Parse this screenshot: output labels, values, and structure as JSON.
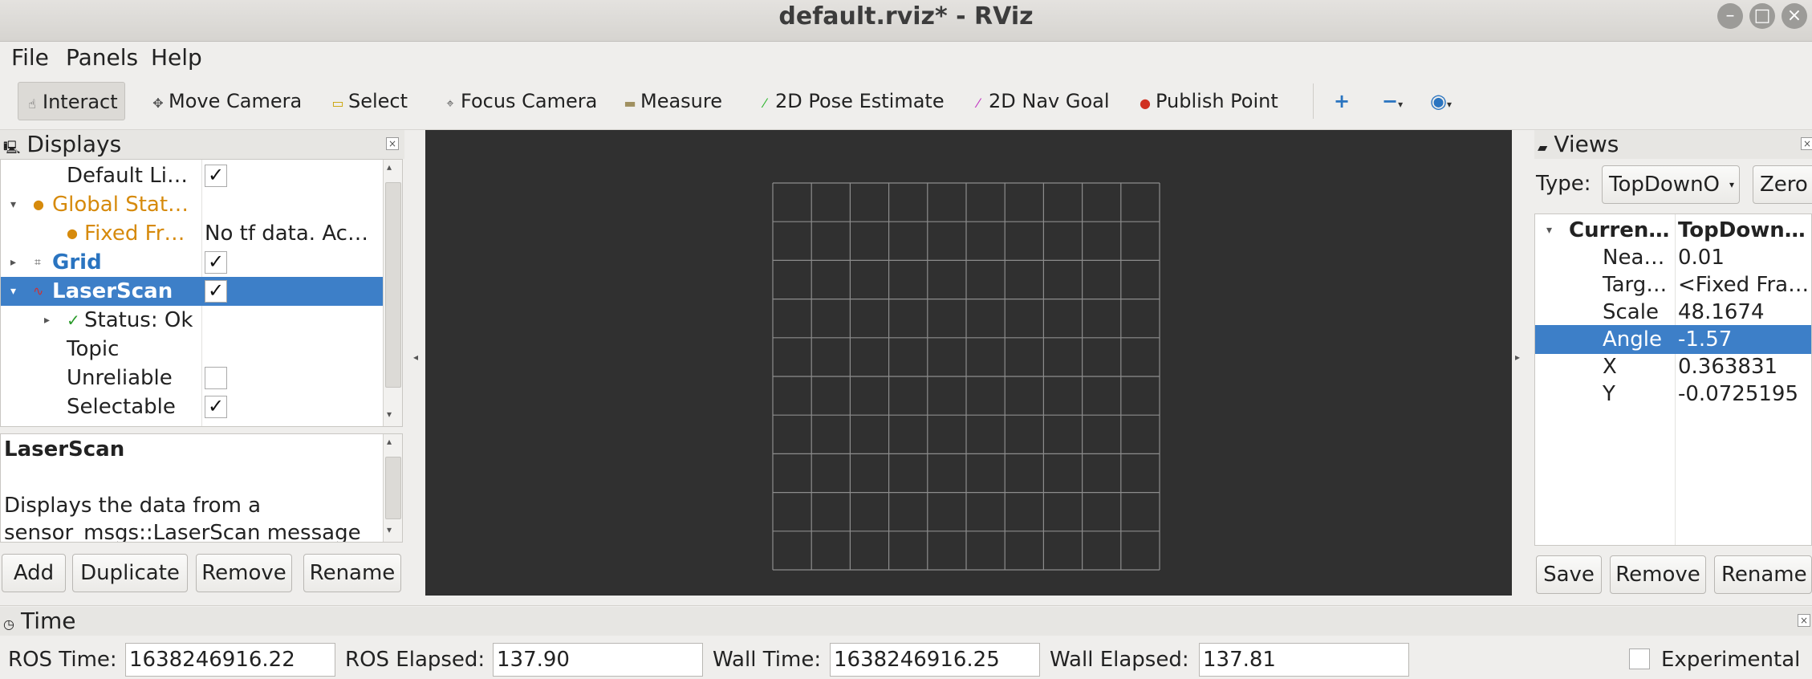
{
  "window": {
    "title": "default.rviz* - RViz"
  },
  "menu": [
    "File",
    "Panels",
    "Help"
  ],
  "toolbar": {
    "interact": "Interact",
    "move_camera": "Move Camera",
    "select": "Select",
    "focus_camera": "Focus Camera",
    "measure": "Measure",
    "pose_estimate": "2D Pose Estimate",
    "nav_goal": "2D Nav Goal",
    "publish_point": "Publish Point",
    "icons": [
      "plus-icon",
      "minus-icon",
      "eye-icon"
    ]
  },
  "displays": {
    "title": "Displays",
    "rows": [
      {
        "label": "Default Li…",
        "value": "✓"
      },
      {
        "label": "Global Stat…",
        "value": ""
      },
      {
        "label": "Fixed Fr…",
        "value": "No tf data.  Ac…"
      },
      {
        "label": "Grid",
        "value": "✓"
      },
      {
        "label": "LaserScan",
        "value": "✓"
      },
      {
        "label": "Status: Ok",
        "value": ""
      },
      {
        "label": "Topic",
        "value": ""
      },
      {
        "label": "Unreliable",
        "value": ""
      },
      {
        "label": "Selectable",
        "value": "✓"
      }
    ],
    "desc_title": "LaserScan",
    "desc_text_1": "Displays the data from a",
    "desc_text_2": "sensor_msgs::LaserScan message",
    "buttons": {
      "add": "Add",
      "duplicate": "Duplicate",
      "remove": "Remove",
      "rename": "Rename"
    }
  },
  "views": {
    "title": "Views",
    "type_label": "Type:",
    "type_value": "TopDownO",
    "zero": "Zero",
    "rows": [
      {
        "label": "Curren…",
        "value": "TopDown…"
      },
      {
        "label": "Nea…",
        "value": "0.01"
      },
      {
        "label": "Targ…",
        "value": "<Fixed Fra…"
      },
      {
        "label": "Scale",
        "value": "48.1674"
      },
      {
        "label": "Angle",
        "value": "-1.57"
      },
      {
        "label": "X",
        "value": "0.363831"
      },
      {
        "label": "Y",
        "value": "-0.0725195"
      }
    ],
    "buttons": {
      "save": "Save",
      "remove": "Remove",
      "rename": "Rename"
    }
  },
  "time": {
    "title": "Time",
    "ros_time_label": "ROS Time:",
    "ros_time": "1638246916.22",
    "ros_elapsed_label": "ROS Elapsed:",
    "ros_elapsed": "137.90",
    "wall_time_label": "Wall Time:",
    "wall_time": "1638246916.25",
    "wall_elapsed_label": "Wall Elapsed:",
    "wall_elapsed": "137.81",
    "experimental": "Experimental"
  },
  "colors": {
    "viewport_bg": "#303030",
    "grid_line": "#a0a0a0",
    "selection": "#3d7fc8",
    "warning": "#d68a0c",
    "link": "#2a74c0"
  }
}
